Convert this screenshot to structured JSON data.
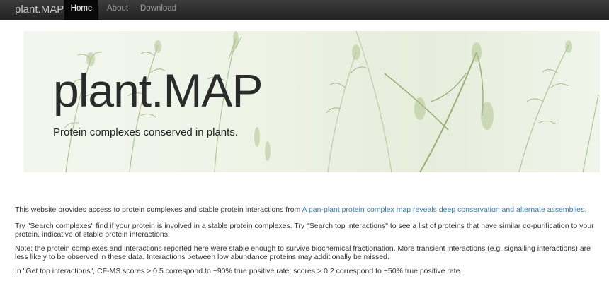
{
  "navbar": {
    "brand": "plant.MAP",
    "items": [
      {
        "label": "Home",
        "active": true
      },
      {
        "label": "About",
        "active": false
      },
      {
        "label": "Download",
        "active": false
      }
    ]
  },
  "hero": {
    "title": "plant.MAP",
    "subtitle": "Protein complexes conserved in plants."
  },
  "content": {
    "intro_text": "This website provides access to protein complexes and stable protein interactions from ",
    "intro_link": "A pan-plant protein complex map reveals deep conservation and alternate assemblies.",
    "paragraph2": "Try \"Search complexes\" find if your protein is involved in a stable protein complexes. Try \"Search top interactions\" to see a list of proteins that have similar co-purification to your protein, indicative of stable protein interactions.",
    "paragraph3": "Note: the protein complexes and interactions reported here were stable enough to survive biochemical fractionation. More transient interactions (e.g. signalling interactions) are less likely to be observed in these data. Interactions between low abundance proteins may additionally be missed.",
    "paragraph4": "In \"Get top interactions\", CF-MS scores > 0.5 correspond to ~90% true positive rate; scores > 0.2 correspond to ~50% true positive rate."
  },
  "colors": {
    "navbar": "#222222",
    "link": "#337ab7",
    "plant_green": "#9bb07a"
  }
}
